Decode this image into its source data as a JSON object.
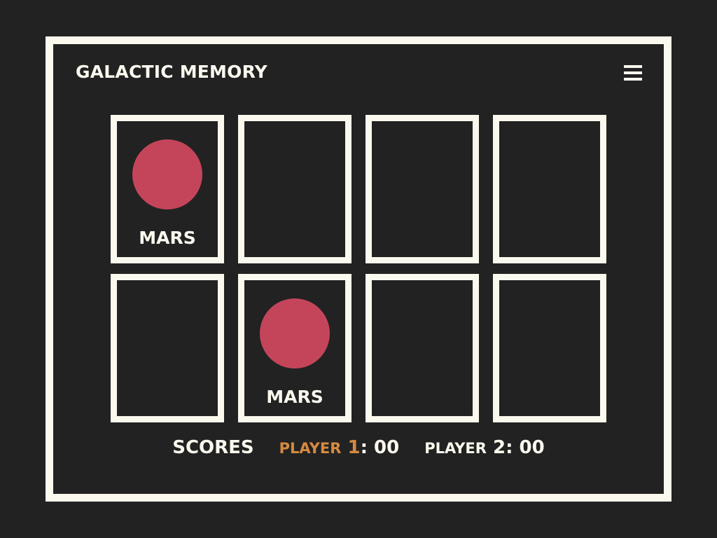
{
  "game": {
    "title": "GALACTIC MEMORY",
    "menu_icon": "hamburger-menu-icon"
  },
  "colors": {
    "background": "#222222",
    "foreground": "#FBF8EE",
    "mars": "#C4455A",
    "active_player": "#D58A40"
  },
  "cards": [
    {
      "face_up": true,
      "label": "MARS",
      "icon": "mars-planet-icon"
    },
    {
      "face_up": false,
      "label": "",
      "icon": ""
    },
    {
      "face_up": false,
      "label": "",
      "icon": ""
    },
    {
      "face_up": false,
      "label": "",
      "icon": ""
    },
    {
      "face_up": false,
      "label": "",
      "icon": ""
    },
    {
      "face_up": true,
      "label": "MARS",
      "icon": "mars-planet-icon"
    },
    {
      "face_up": false,
      "label": "",
      "icon": ""
    },
    {
      "face_up": false,
      "label": "",
      "icon": ""
    }
  ],
  "scores": {
    "title": "SCORES",
    "player1": {
      "name": "PLAYER",
      "number": "1",
      "score_text": ": 00",
      "active": true
    },
    "player2": {
      "name": "PLAYER",
      "number": "2",
      "score_text": ": 00",
      "active": false
    }
  }
}
